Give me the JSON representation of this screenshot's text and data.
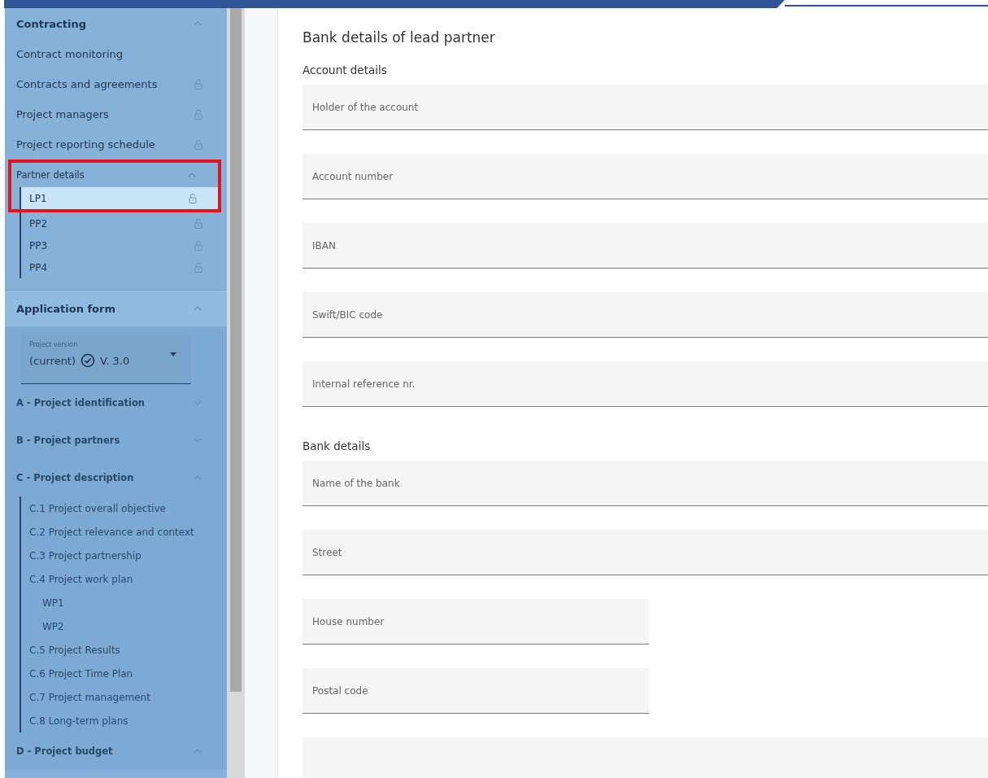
{
  "sidebar": {
    "sections": [
      {
        "title": "Contracting",
        "kind": "links",
        "expanded": true,
        "items": [
          {
            "label": "Contract monitoring",
            "locked": false
          },
          {
            "label": "Contracts and agreements",
            "locked": true
          },
          {
            "label": "Project managers",
            "locked": true
          },
          {
            "label": "Project reporting schedule",
            "locked": true
          },
          {
            "label": "Partner details",
            "expanded": true,
            "highlighted": true,
            "children": [
              {
                "label": "LP1",
                "locked": true,
                "selected": true
              },
              {
                "label": "PP2",
                "locked": true,
                "selected": false
              },
              {
                "label": "PP3",
                "locked": true,
                "selected": false
              },
              {
                "label": "PP4",
                "locked": true,
                "selected": false
              }
            ]
          }
        ]
      },
      {
        "title": "Application form",
        "kind": "outline",
        "expanded": true,
        "version_select": {
          "label": "Project version",
          "value": "(current)",
          "version": "V. 3.0",
          "current": true
        },
        "items": [
          {
            "label": "A - Project identification",
            "expanded": false
          },
          {
            "label": "B - Project partners",
            "expanded": false
          },
          {
            "label": "C - Project description",
            "expanded": true,
            "children": [
              {
                "label": "C.1 Project overall objective"
              },
              {
                "label": "C.2 Project relevance and context"
              },
              {
                "label": "C.3 Project partnership"
              },
              {
                "label": "C.4 Project work plan",
                "children": [
                  {
                    "label": "WP1"
                  },
                  {
                    "label": "WP2"
                  }
                ]
              },
              {
                "label": "C.5 Project Results"
              },
              {
                "label": "C.6 Project Time Plan"
              },
              {
                "label": "C.7 Project management"
              },
              {
                "label": "C.8 Long-term plans"
              }
            ]
          },
          {
            "label": "D - Project budget",
            "expanded": true
          }
        ]
      }
    ]
  },
  "main": {
    "title": "Bank details of lead partner",
    "groups": [
      {
        "heading": "Account details",
        "fields": [
          {
            "placeholder": "Holder of the account",
            "kind": "full"
          },
          {
            "placeholder": "Account number",
            "kind": "full"
          },
          {
            "placeholder": "IBAN",
            "kind": "full"
          },
          {
            "placeholder": "Swift/BIC code",
            "kind": "full"
          },
          {
            "placeholder": "Internal reference nr.",
            "kind": "full"
          }
        ]
      },
      {
        "heading": "Bank details",
        "fields": [
          {
            "placeholder": "Name of the bank",
            "kind": "full"
          },
          {
            "placeholder": "Street",
            "kind": "full"
          },
          {
            "placeholder": "House number",
            "kind": "half"
          },
          {
            "placeholder": "Postal code",
            "kind": "half"
          },
          {
            "kind": "full"
          }
        ]
      }
    ]
  }
}
